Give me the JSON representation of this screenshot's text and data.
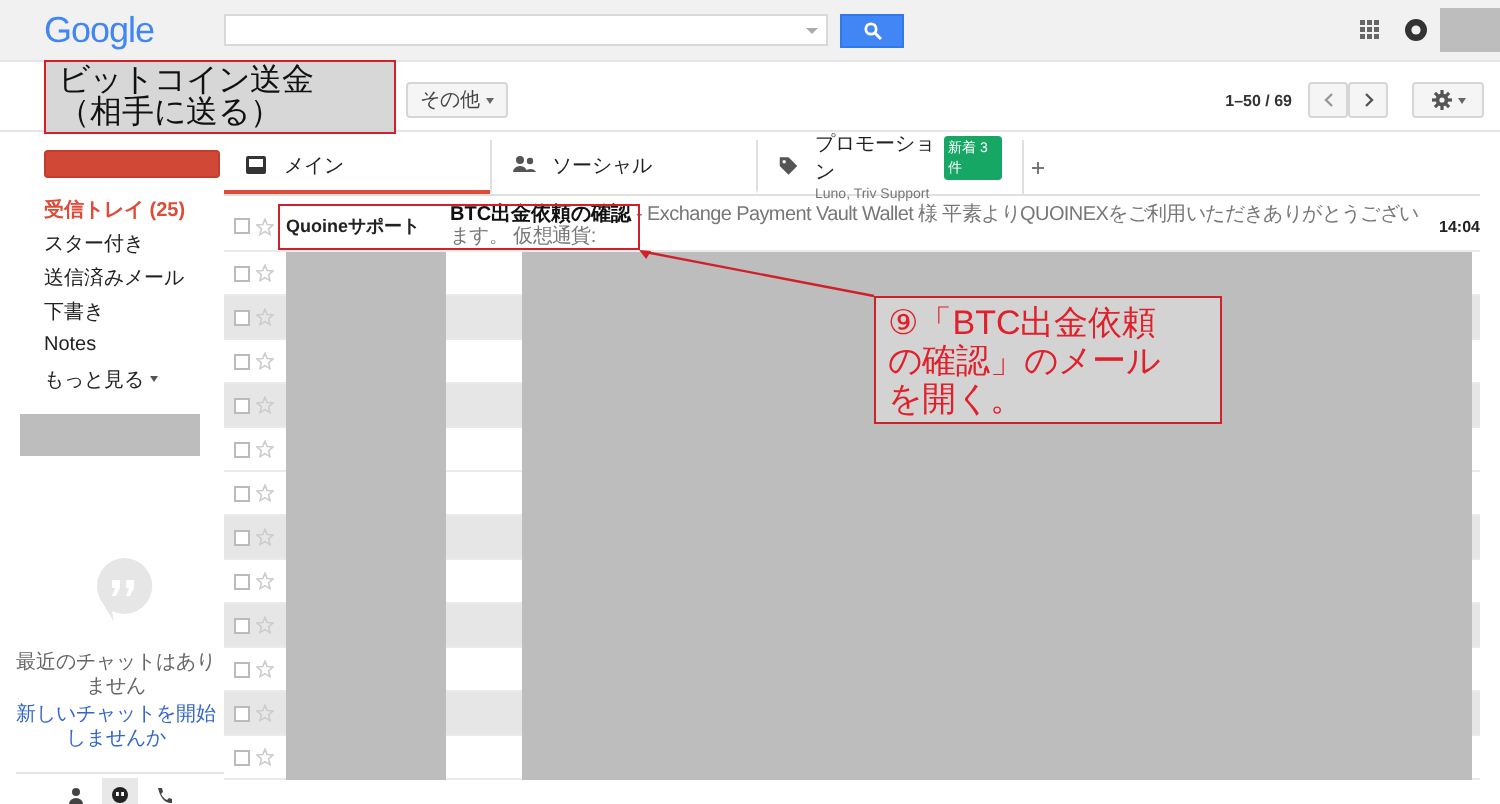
{
  "header": {
    "logo": "Google"
  },
  "toolbar": {
    "more_button": "その他",
    "pagination": "1–50 / 69"
  },
  "sidebar": {
    "nav": [
      {
        "label": "受信トレイ (25)",
        "selected": true,
        "kind": "link"
      },
      {
        "label": "スター付き",
        "selected": false,
        "kind": "link"
      },
      {
        "label": "送信済みメール",
        "selected": false,
        "kind": "link"
      },
      {
        "label": "下書き",
        "selected": false,
        "kind": "link"
      },
      {
        "label": "Notes",
        "selected": false,
        "kind": "link"
      },
      {
        "label": "もっと見る",
        "selected": false,
        "kind": "more"
      }
    ],
    "chat_empty": "最近のチャットはありません",
    "chat_link": "新しいチャットを開始しませんか",
    "chat_modes": [
      {
        "kind": "person",
        "selected": false
      },
      {
        "kind": "chat",
        "selected": true
      },
      {
        "kind": "phone",
        "selected": false
      }
    ]
  },
  "tabs": [
    {
      "kind": "primary",
      "label": "メイン",
      "selected": true
    },
    {
      "kind": "social",
      "label": "ソーシャル",
      "selected": false
    },
    {
      "kind": "promotions",
      "label": "プロモーション",
      "badge": "新着 3 件",
      "subtitle": "Luno, Triv Support",
      "selected": false
    }
  ],
  "messages": [
    {
      "kind": "message",
      "read": false,
      "sender": "Quoineサポート",
      "preview": "**BTC出金依頼の確認** - Exchange Payment Vault Wallet 様 平素よりQUOINEXをご利用いただきありがとうございます。 仮想通貨:",
      "time": "14:04"
    },
    {
      "kind": "redacted",
      "read": false
    },
    {
      "kind": "redacted",
      "read": true
    },
    {
      "kind": "redacted",
      "read": false
    },
    {
      "kind": "redacted",
      "read": true
    },
    {
      "kind": "redacted",
      "read": false
    },
    {
      "kind": "redacted",
      "read": false
    },
    {
      "kind": "redacted",
      "read": true
    },
    {
      "kind": "redacted",
      "read": false
    },
    {
      "kind": "redacted",
      "read": true
    },
    {
      "kind": "redacted",
      "read": false
    },
    {
      "kind": "redacted",
      "read": true
    },
    {
      "kind": "redacted",
      "read": false
    }
  ],
  "annotations": [
    {
      "kind": "callout",
      "color": "#111111",
      "lines": [
        "ビットコイン送金",
        "（相手に送る）"
      ]
    },
    {
      "kind": "callout",
      "color": "#e0202a",
      "lines": [
        "⑨「BTC出金依頼",
        "の確認」のメール",
        "を開く。"
      ]
    },
    {
      "kind": "highlight",
      "color": "#d0202a"
    }
  ]
}
